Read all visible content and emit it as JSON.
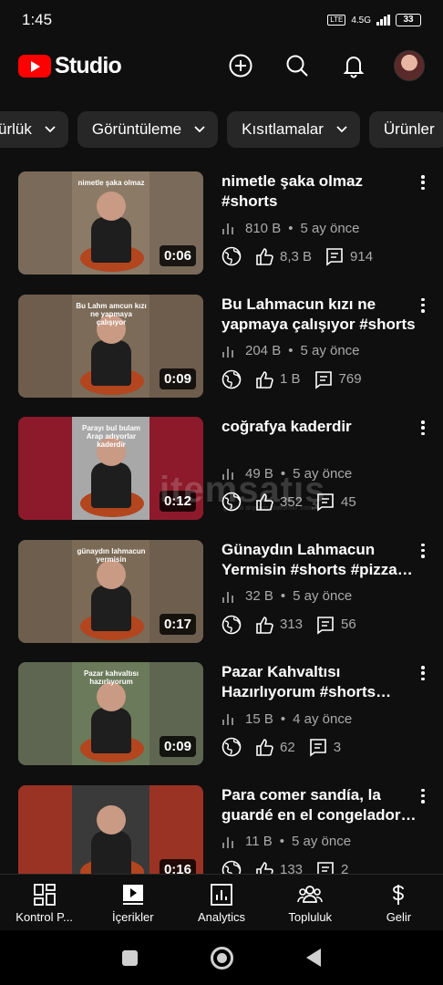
{
  "status": {
    "time": "1:45",
    "network": "4.5G",
    "volte": "LTE",
    "battery": "33"
  },
  "app": {
    "logo_text": "Studio",
    "brand_color": "#ff0000"
  },
  "appbar": {
    "icons": [
      "add-icon",
      "search-icon",
      "bell-icon",
      "avatar"
    ]
  },
  "chips": [
    {
      "label": "ürlük"
    },
    {
      "label": "Görüntüleme"
    },
    {
      "label": "Kısıtlamalar"
    },
    {
      "label": "Ürünler"
    }
  ],
  "videos": [
    {
      "title": "nimetle şaka olmaz #shorts",
      "thumb_caption": "nimetle şaka olmaz",
      "duration": "0:06",
      "views": "810 B",
      "age": "5 ay önce",
      "likes": "8,3 B",
      "comments": "914",
      "thumb_bg": "#7a6a5a",
      "inner_bg": "#8a7a66"
    },
    {
      "title": "Bu Lahmacun kızı ne yapmaya çalışıyor #shorts",
      "thumb_caption": "Bu Lahm amcun kızı ne yapmaya çalışıyor",
      "duration": "0:09",
      "views": "204 B",
      "age": "5 ay önce",
      "likes": "1 B",
      "comments": "769",
      "thumb_bg": "#6e5d4c",
      "inner_bg": "#7c6b58"
    },
    {
      "title": "coğrafya kaderdir",
      "thumb_caption": "Parayı bul bulam Arap adıyorlar kaderdir",
      "duration": "0:12",
      "views": "49 B",
      "age": "5 ay önce",
      "likes": "352",
      "comments": "45",
      "thumb_bg": "#8c1a2b",
      "inner_bg": "#a8a8a8"
    },
    {
      "title": "Günaydın Lahmacun Yermisin #shorts #pizza #food",
      "thumb_caption": "günaydın lahmacun yermisin",
      "duration": "0:17",
      "views": "32 B",
      "age": "5 ay önce",
      "likes": "313",
      "comments": "56",
      "thumb_bg": "#6d5e4e",
      "inner_bg": "#7b6a56"
    },
    {
      "title": "Pazar Kahvaltısı Hazırlıyorum #shorts #lahmacun",
      "thumb_caption": "Pazar kahvaltısı hazırlıyorum",
      "duration": "0:09",
      "views": "15 B",
      "age": "4 ay önce",
      "likes": "62",
      "comments": "3",
      "thumb_bg": "#5e6550",
      "inner_bg": "#6b7a5a"
    },
    {
      "title": "Para comer sandía, la guardé en el congelador #shorts",
      "thumb_caption": "",
      "duration": "0:16",
      "views": "11 B",
      "age": "5 ay önce",
      "likes": "133",
      "comments": "2",
      "thumb_bg": "#9a3324",
      "inner_bg": "#3a3a3a"
    }
  ],
  "watermark": {
    "text": "itemsatış",
    "sub": "güvenli alışveriş platformu .com"
  },
  "bottom_nav": [
    {
      "label": "Kontrol P...",
      "icon": "dashboard-icon"
    },
    {
      "label": "İçerikler",
      "icon": "content-icon"
    },
    {
      "label": "Analytics",
      "icon": "analytics-icon"
    },
    {
      "label": "Topluluk",
      "icon": "community-icon"
    },
    {
      "label": "Gelir",
      "icon": "earn-icon"
    }
  ]
}
